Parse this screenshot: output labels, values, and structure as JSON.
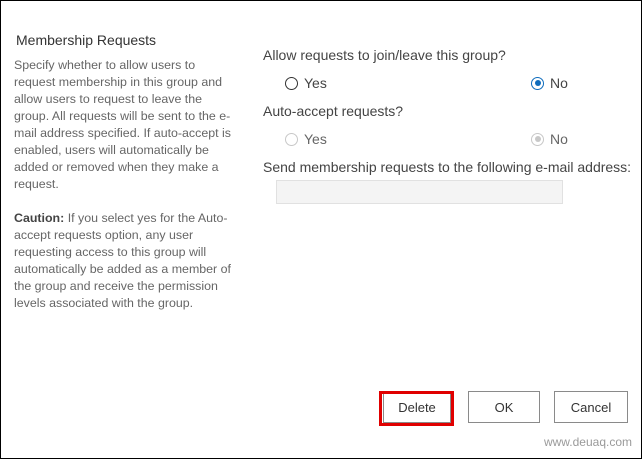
{
  "section": {
    "title": "Membership Requests",
    "description": "Specify whether to allow users to request membership in this group and allow users to request to leave the group. All requests will be sent to the e-mail address specified. If auto-accept is enabled, users will automatically be added or removed when they make a request.",
    "caution_label": "Caution:",
    "caution_text": " If you select yes for the Auto-accept requests option, any user requesting access to this group will automatically be added as a member of the group and receive the permission levels associated with the group."
  },
  "allow_requests": {
    "question": "Allow requests to join/leave this group?",
    "yes_label": "Yes",
    "no_label": "No",
    "selected": "No"
  },
  "auto_accept": {
    "question": "Auto-accept requests?",
    "yes_label": "Yes",
    "no_label": "No",
    "selected": "No",
    "disabled": true
  },
  "email": {
    "question": "Send membership requests to the following e-mail address:",
    "value": ""
  },
  "buttons": {
    "delete_label": "Delete",
    "ok_label": "OK",
    "cancel_label": "Cancel"
  },
  "watermark": "www.deuaq.com",
  "colors": {
    "accent": "#0f6cbd",
    "highlight": "#e00000"
  }
}
